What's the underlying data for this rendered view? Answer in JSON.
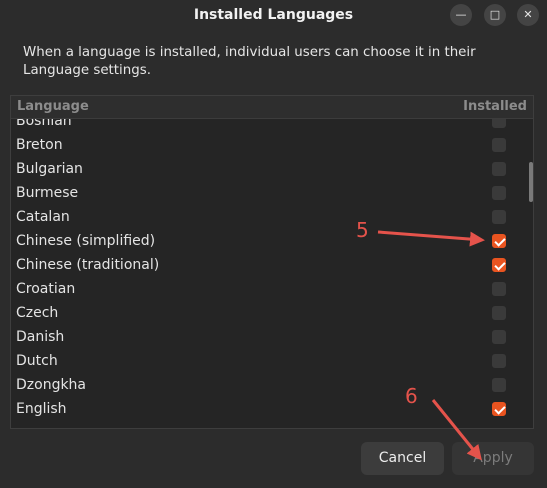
{
  "window": {
    "title": "Installed Languages",
    "controls": {
      "minimize": "—",
      "maximize": "□",
      "close": "✕"
    }
  },
  "description": "When a language is installed, individual users can choose it in their Language settings.",
  "list": {
    "headers": {
      "language": "Language",
      "installed": "Installed"
    },
    "rows": [
      {
        "label": "Bosnian",
        "checked": false
      },
      {
        "label": "Breton",
        "checked": false
      },
      {
        "label": "Bulgarian",
        "checked": false
      },
      {
        "label": "Burmese",
        "checked": false
      },
      {
        "label": "Catalan",
        "checked": false
      },
      {
        "label": "Chinese (simplified)",
        "checked": true
      },
      {
        "label": "Chinese (traditional)",
        "checked": true
      },
      {
        "label": "Croatian",
        "checked": false
      },
      {
        "label": "Czech",
        "checked": false
      },
      {
        "label": "Danish",
        "checked": false
      },
      {
        "label": "Dutch",
        "checked": false
      },
      {
        "label": "Dzongkha",
        "checked": false
      },
      {
        "label": "English",
        "checked": true
      }
    ]
  },
  "buttons": {
    "cancel": "Cancel",
    "apply": "Apply"
  },
  "annotations": {
    "step5": "5",
    "step6": "6"
  },
  "colors": {
    "accent": "#e95420",
    "annotation": "#e5534b"
  }
}
